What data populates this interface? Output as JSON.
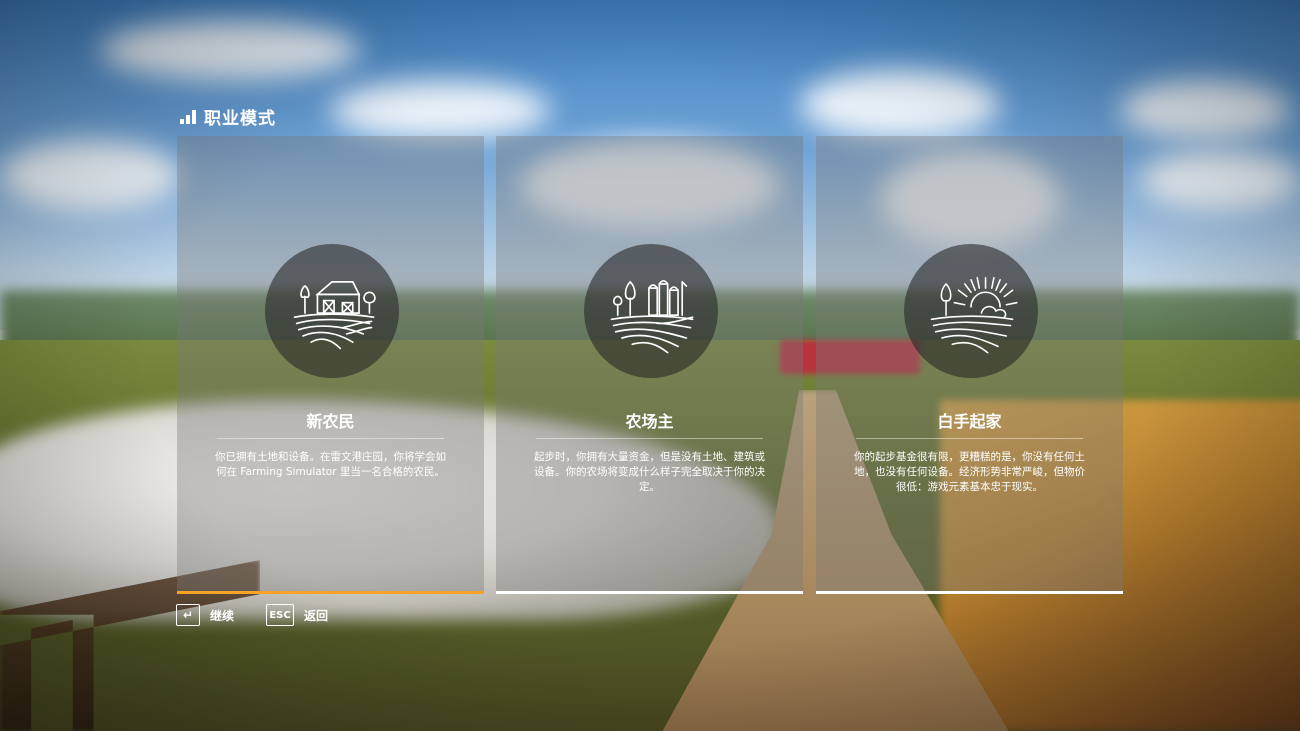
{
  "header": {
    "title": "职业模式",
    "icon": "signal-bars-icon"
  },
  "cards": [
    {
      "title": "新农民",
      "icon": "barn-emblem-icon",
      "description": "你已拥有土地和设备。在雷文港庄园，你将学会如何在 Farming Simulator 里当一名合格的农民。",
      "selected": true,
      "accent": "#f4a326"
    },
    {
      "title": "农场主",
      "icon": "silo-emblem-icon",
      "description": "起步时，你拥有大量资金，但是没有土地、建筑或设备。你的农场将变成什么样子完全取决于你的决定。",
      "selected": false,
      "accent": "#ffffff"
    },
    {
      "title": "白手起家",
      "icon": "sunrise-emblem-icon",
      "description": "你的起步基金很有限，更糟糕的是，你没有任何土地，也没有任何设备。经济形势非常严峻，但物价很低：游戏元素基本忠于现实。",
      "selected": false,
      "accent": "#ffffff"
    }
  ],
  "footer": {
    "continue_key": "↵",
    "continue_label": "继续",
    "back_key": "ESC",
    "back_label": "返回"
  }
}
